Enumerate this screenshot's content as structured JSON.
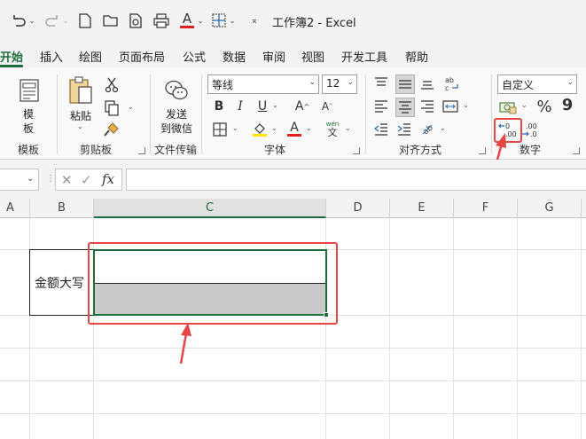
{
  "window": {
    "title": "工作簿2  -  Excel"
  },
  "menu": {
    "tabs": [
      "开始",
      "插入",
      "绘图",
      "页面布局",
      "公式",
      "数据",
      "审阅",
      "视图",
      "开发工具",
      "帮助"
    ]
  },
  "ribbon": {
    "template": {
      "label_line1": "模",
      "label_line2": "板",
      "group": "模板"
    },
    "clipboard": {
      "paste_label": "粘贴",
      "group": "剪贴板"
    },
    "file_transfer": {
      "label_line1": "发送",
      "label_line2": "到微信",
      "group": "文件传输"
    },
    "font": {
      "name": "等线",
      "size": "12",
      "group": "字体",
      "bold": "B",
      "italic": "I",
      "underline": "U",
      "pinyin": "wén",
      "pinyin_char": "文"
    },
    "alignment": {
      "group": "对齐方式"
    },
    "number": {
      "format": "自定义",
      "group": "数字",
      "percent": "%",
      "comma": "9"
    }
  },
  "formula_bar": {
    "fx": "fx",
    "value": ""
  },
  "sheet": {
    "columns": [
      "A",
      "B",
      "C",
      "D",
      "E",
      "F",
      "G"
    ],
    "selected_column": "C",
    "cell_b_text": "金额大写"
  },
  "colors": {
    "accent": "#1e6e3c",
    "annotation": "#e84545",
    "font_color": "#e02020",
    "highlight_color": "#ffe600"
  }
}
